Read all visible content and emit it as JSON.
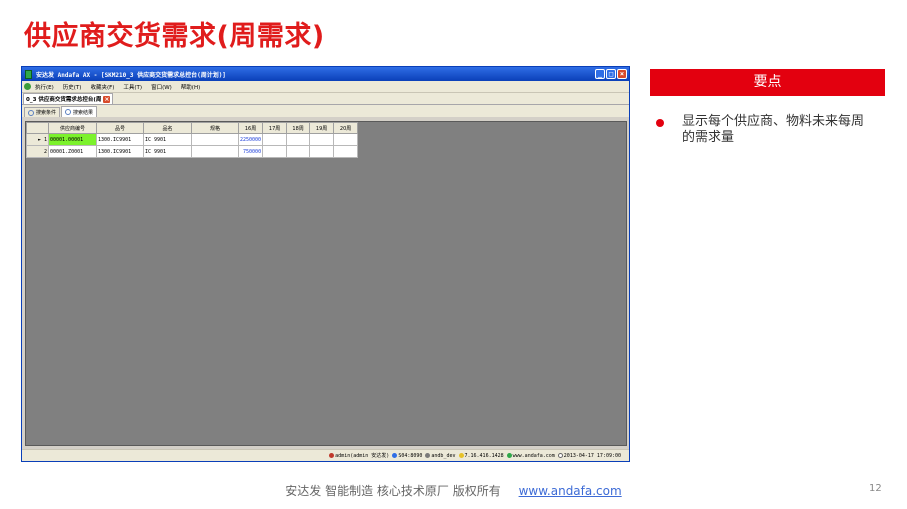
{
  "slide": {
    "title": "供应商交货需求(周需求)",
    "page_number": "12"
  },
  "window": {
    "title": "安达发 Andafa AX - [SKM210_3 供应商交货需求总控台(周计划)]",
    "buttons": [
      "_",
      "□",
      "×"
    ]
  },
  "menu": {
    "items": [
      "执行(E)",
      "历史(T)",
      "收藏夹(F)",
      "工具(T)",
      "窗口(W)",
      "帮助(H)"
    ]
  },
  "doc_tab": {
    "label": "0_3 供应商交货需求总控台(周"
  },
  "sub_tabs": [
    {
      "label": "搜索条件"
    },
    {
      "label": "搜索结果"
    }
  ],
  "grid": {
    "columns": [
      "",
      "供应商编号",
      "品号",
      "品名",
      "规格",
      "16周",
      "17周",
      "18周",
      "19周",
      "20周"
    ],
    "rows": [
      {
        "index": "1",
        "cells": [
          "00001.00001",
          "1300.IC9901",
          "IC 9901",
          "",
          "2250000",
          "",
          "",
          "",
          ""
        ]
      },
      {
        "index": "2",
        "cells": [
          "00001.Z0001",
          "1300.IC9901",
          "IC 9901",
          "",
          "750000",
          "",
          "",
          "",
          ""
        ]
      }
    ]
  },
  "status_bar": {
    "user": "admin(admin 安达发)",
    "server": "S04:8090",
    "db": "andb_dev",
    "ip": "7.16.416.1428",
    "site": "www.andafa.com",
    "time": "2013-04-17 17:09:00"
  },
  "key_points": {
    "header": "要点",
    "bullets": [
      "显示每个供应商、物料未来每周的需求量"
    ]
  },
  "footer": {
    "text": "安达发   智能制造 核心技术原厂    版权所有",
    "link": "www.andafa.com"
  },
  "colors": {
    "title_red": "#e01c1c",
    "header_red": "#e3000f",
    "highlight_green": "#7cf22c",
    "link_blue": "#3d6bd6"
  }
}
